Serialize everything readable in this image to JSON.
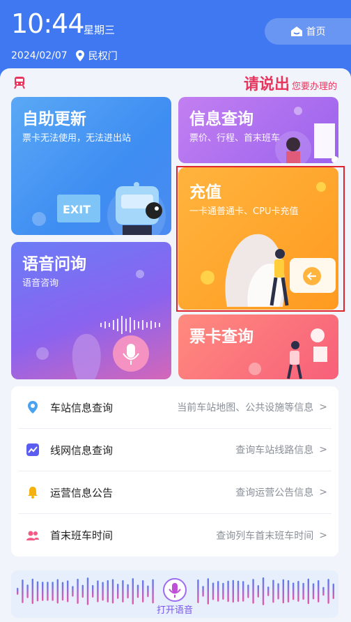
{
  "header": {
    "time": "10:44",
    "weekday": "星期三",
    "date": "2024/02/07",
    "station": "民权门",
    "home_label": "首页"
  },
  "prompt": {
    "main": "请说出",
    "sub": "您要办理的"
  },
  "cards": {
    "self_update": {
      "title": "自助更新",
      "subtitle": "票卡无法使用，无法进出站",
      "exit_sign": "EXIT"
    },
    "info_query": {
      "title": "信息查询",
      "subtitle": "票价、行程、首末班车"
    },
    "recharge": {
      "title": "充值",
      "subtitle": "一卡通普通卡、CPU卡充值"
    },
    "voice_query": {
      "title": "语音问询",
      "subtitle": "语音咨询"
    },
    "ticket_query": {
      "title": "票卡查询"
    }
  },
  "list": [
    {
      "icon": "map-pin-icon",
      "label": "车站信息查询",
      "desc": "当前车站地图、公共设施等信息",
      "arrow": ">"
    },
    {
      "icon": "line-chart-icon",
      "label": "线网信息查询",
      "desc": "查询车站线路信息",
      "arrow": ">"
    },
    {
      "icon": "bell-icon",
      "label": "运营信息公告",
      "desc": "查询运营公告信息",
      "arrow": ">"
    },
    {
      "icon": "people-icon",
      "label": "首末班车时间",
      "desc": "查询列车首末班车时间",
      "arrow": ">"
    }
  ],
  "voice_bar": {
    "label": "打开语音"
  },
  "colors": {
    "header": "#3f78f0",
    "accent_red": "#e8355e",
    "highlight": "#e0242e"
  }
}
